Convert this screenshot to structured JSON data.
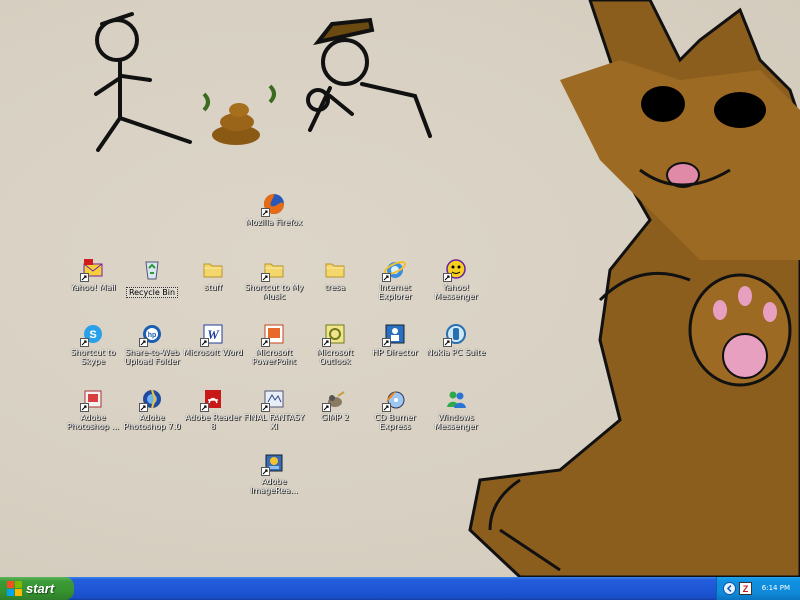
{
  "desktop": {
    "icons": [
      {
        "label": "Mozilla Firefox",
        "icon": "firefox-icon"
      },
      {
        "label": "Yahoo! Mail",
        "icon": "yahoo-mail-icon"
      },
      {
        "label": "Recycle Bin",
        "icon": "recycle-bin-icon"
      },
      {
        "label": "stuff",
        "icon": "folder-icon"
      },
      {
        "label": "Shortcut to My Music",
        "icon": "folder-icon"
      },
      {
        "label": "tresa",
        "icon": "folder-icon"
      },
      {
        "label": "Internet Explorer",
        "icon": "internet-explorer-icon"
      },
      {
        "label": "Yahoo! Messenger",
        "icon": "yahoo-messenger-icon"
      },
      {
        "label": "Shortcut to Skype",
        "icon": "skype-icon"
      },
      {
        "label": "Share-to-Web Upload Folder",
        "icon": "hp-share-icon"
      },
      {
        "label": "Microsoft Word",
        "icon": "word-icon"
      },
      {
        "label": "Microsoft PowerPoint",
        "icon": "powerpoint-icon"
      },
      {
        "label": "Microsoft Outlook",
        "icon": "outlook-icon"
      },
      {
        "label": "HP Director",
        "icon": "hp-director-icon"
      },
      {
        "label": "Nokia PC Suite",
        "icon": "nokia-icon"
      },
      {
        "label": "Adobe Photoshop ...",
        "icon": "photoshop-album-icon"
      },
      {
        "label": "Adobe Photoshop 7.0",
        "icon": "photoshop-icon"
      },
      {
        "label": "Adobe Reader 8",
        "icon": "adobe-reader-icon"
      },
      {
        "label": "FINAL FANTASY XI",
        "icon": "ffxi-icon"
      },
      {
        "label": "GIMP 2",
        "icon": "gimp-icon"
      },
      {
        "label": "CD Burner Express",
        "icon": "cd-burner-icon"
      },
      {
        "label": "Windows Messenger",
        "icon": "windows-messenger-icon"
      },
      {
        "label": "Adobe ImageRea...",
        "icon": "imageready-icon"
      }
    ]
  },
  "taskbar": {
    "start_label": "start",
    "clock": "6:14 PM"
  },
  "colors": {
    "taskbar_blue": "#245edb",
    "start_green": "#3c9b39",
    "tray_blue": "#108fe0"
  }
}
